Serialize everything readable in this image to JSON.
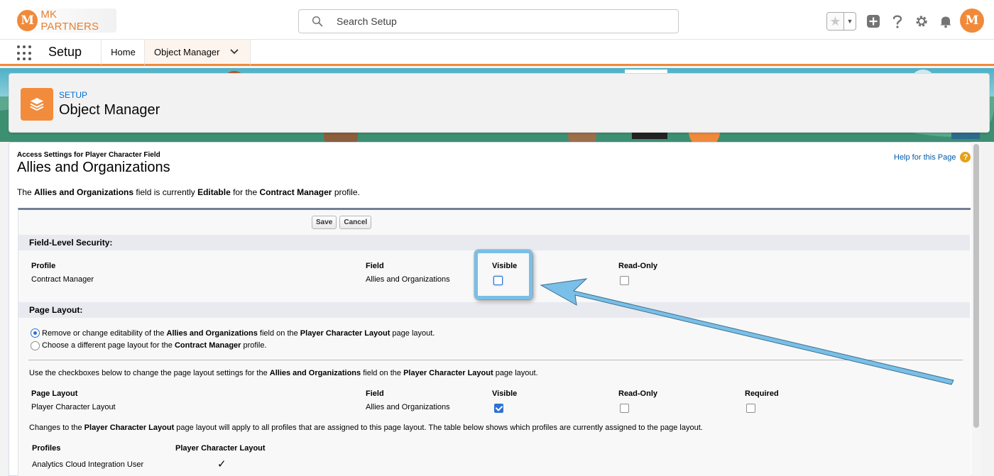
{
  "header": {
    "logo_text": "MK PARTNERS",
    "logo_badge": "M",
    "search_placeholder": "Search Setup",
    "avatar_initial": "M",
    "icons": [
      "star-icon",
      "chevron-down-icon",
      "add-icon",
      "help-icon",
      "gear-icon",
      "bell-icon"
    ]
  },
  "nav": {
    "app_name": "Setup",
    "items": [
      {
        "label": "Home"
      },
      {
        "label": "Object Manager"
      }
    ]
  },
  "setup_card": {
    "label": "SETUP",
    "title": "Object Manager"
  },
  "page": {
    "subtitle": "Access Settings for Player Character Field",
    "title": "Allies and Organizations",
    "help_link": "Help for this Page",
    "desc_1": "The ",
    "desc_field": "Allies and Organizations",
    "desc_2": " field is currently ",
    "desc_access": "Editable",
    "desc_3": " for the ",
    "desc_profile": "Contract Manager",
    "desc_4": " profile."
  },
  "buttons": {
    "save": "Save",
    "cancel": "Cancel"
  },
  "fls": {
    "heading": "Field-Level Security:",
    "columns": [
      "Profile",
      "Field",
      "Visible",
      "Read-Only"
    ],
    "row": {
      "profile": "Contract Manager",
      "field": "Allies and Organizations",
      "visible": false,
      "read_only": false
    }
  },
  "page_layout": {
    "heading": "Page Layout:",
    "option1": {
      "selected": true,
      "t1": "Remove or change editability of the ",
      "field": "Allies and Organizations",
      "t2": " field on the ",
      "layout": "Player Character Layout",
      "t3": " page layout."
    },
    "option2": {
      "selected": false,
      "t1": "Choose a different page layout for the ",
      "profile": "Contract Manager",
      "t2": " profile."
    },
    "instr": {
      "t1": "Use the checkboxes below to change the page layout settings for the ",
      "field": "Allies and Organizations",
      "t2": " field on the ",
      "layout": "Player Character Layout",
      "t3": " page layout."
    },
    "columns": [
      "Page Layout",
      "Field",
      "Visible",
      "Read-Only",
      "Required"
    ],
    "row": {
      "layout": "Player Character Layout",
      "field": "Allies and Organizations",
      "visible": true,
      "read_only": false,
      "required": false
    },
    "note": {
      "t1": "Changes to the ",
      "layout": "Player Character Layout",
      "t2": " page layout will apply to all profiles that are assigned to this page layout. The table below shows which profiles are currently assigned to the page layout."
    },
    "profiles_columns": [
      "Profiles",
      "Player Character Layout"
    ],
    "profiles": [
      {
        "name": "Analytics Cloud Integration User",
        "mark": "✓"
      }
    ]
  },
  "colors": {
    "brand_orange": "#f08a3a",
    "link_blue": "#0070d2",
    "checkbox_blue": "#2e72d2",
    "annotation_blue": "#79bfe7"
  }
}
